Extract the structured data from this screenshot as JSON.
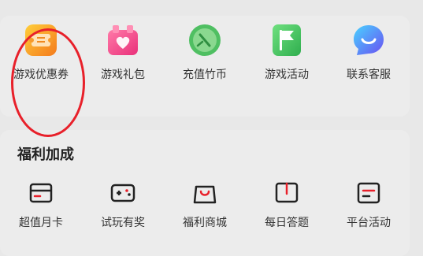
{
  "top_items": [
    {
      "label": "游戏优惠券",
      "icon": "coupon-icon"
    },
    {
      "label": "游戏礼包",
      "icon": "gift-icon"
    },
    {
      "label": "充值竹币",
      "icon": "bamboo-coin-icon"
    },
    {
      "label": "游戏活动",
      "icon": "flag-icon"
    },
    {
      "label": "联系客服",
      "icon": "chat-icon"
    }
  ],
  "section": {
    "title": "福利加成"
  },
  "bottom_items": [
    {
      "label": "超值月卡",
      "icon": "card-icon"
    },
    {
      "label": "试玩有奖",
      "icon": "gamepad-icon"
    },
    {
      "label": "福利商城",
      "icon": "shopping-bag-icon"
    },
    {
      "label": "每日答题",
      "icon": "book-icon"
    },
    {
      "label": "平台活动",
      "icon": "list-icon"
    }
  ],
  "colors": {
    "accent": "#e8202a",
    "annotation": "#e8202a",
    "coupon": "#f5a623",
    "gift": "#f04a86",
    "coin": "#4fbf62",
    "flag": "#3dbd5c",
    "chat": "#4f6df0"
  }
}
